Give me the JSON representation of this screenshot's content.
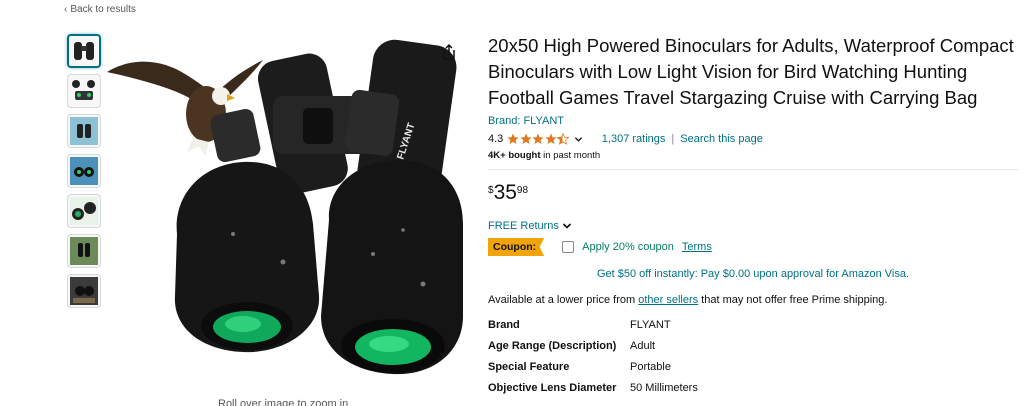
{
  "nav": {
    "back_label": "Back to results"
  },
  "gallery": {
    "thumbnails": [
      "binoculars-front",
      "binoculars-kit",
      "binoculars-scene",
      "binoculars-features",
      "binoculars-lens",
      "binoculars-outdoor",
      "binoculars-use"
    ],
    "main_image": "binoculars-with-eagle",
    "zoom_hint": "Roll over image to zoom in",
    "product_brand_print": "FLYANT"
  },
  "product": {
    "title": "20x50 High Powered Binoculars for Adults, Waterproof Compact Binoculars with Low Light Vision for Bird Watching Hunting Football Games Travel Stargazing Cruise with Carrying Bag",
    "brand_link": "Brand: FLYANT",
    "rating": "4.3",
    "rating_value": 4.3,
    "ratings_count": "1,307 ratings",
    "search_page": "Search this page",
    "bought_bold": "4K+ bought",
    "bought_rest": " in past month",
    "price_symbol": "$",
    "price_whole": "35",
    "price_fraction": "98",
    "free_returns": "FREE Returns",
    "coupon_label": "Coupon:",
    "coupon_text": "Apply 20% coupon",
    "coupon_terms": "Terms",
    "visa_offer": "Get $50 off instantly: Pay $0.00 upon approval for Amazon Visa.",
    "lower_price_pre": "Available at a lower price from ",
    "lower_price_link": "other sellers",
    "lower_price_post": " that may not offer free Prime shipping."
  },
  "specs": [
    {
      "key": "Brand",
      "value": "FLYANT"
    },
    {
      "key": "Age Range (Description)",
      "value": "Adult"
    },
    {
      "key": "Special Feature",
      "value": "Portable"
    },
    {
      "key": "Objective Lens Diameter",
      "value": "50 Millimeters"
    }
  ],
  "colors": {
    "link": "#007185",
    "star": "#de7921",
    "coupon": "#f0a30a",
    "coupon_green": "#067d62"
  }
}
